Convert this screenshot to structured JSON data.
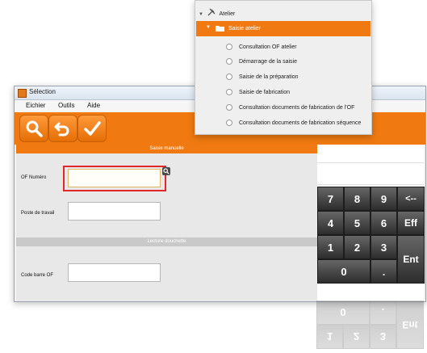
{
  "window": {
    "title": "Sélection",
    "menu": [
      "Eichier",
      "Outils",
      "Aide"
    ]
  },
  "toolbar": {
    "buttons": [
      "search-icon",
      "undo-icon",
      "check-icon"
    ]
  },
  "form": {
    "manual_section": "Saisie manuelle",
    "of_label": "OF Numéro",
    "of_value": "",
    "post_label": "Poste de travail",
    "post_value": "",
    "scan_section": "Lecture douchette",
    "barcode_label": "Code barre OF",
    "barcode_value": ""
  },
  "keypad": {
    "display": "",
    "keys": [
      "7",
      "8",
      "9",
      "<--",
      "4",
      "5",
      "6",
      "Eff",
      "1",
      "2",
      "3",
      "Ent",
      "0",
      "."
    ]
  },
  "tree": {
    "root": "Atelier",
    "selected": "Saisie atelier",
    "items": [
      "Consultation OF atelier",
      "Démarrage de la saisie",
      "Saisie de la préparation",
      "Saisie de fabrication",
      "Consultation documents de fabrication de l'OF",
      "Consultation documents de fabrication séquence"
    ]
  },
  "colors": {
    "accent": "#f07a11",
    "highlight": "#e3262a",
    "key_bg": "#3a3a3a"
  }
}
